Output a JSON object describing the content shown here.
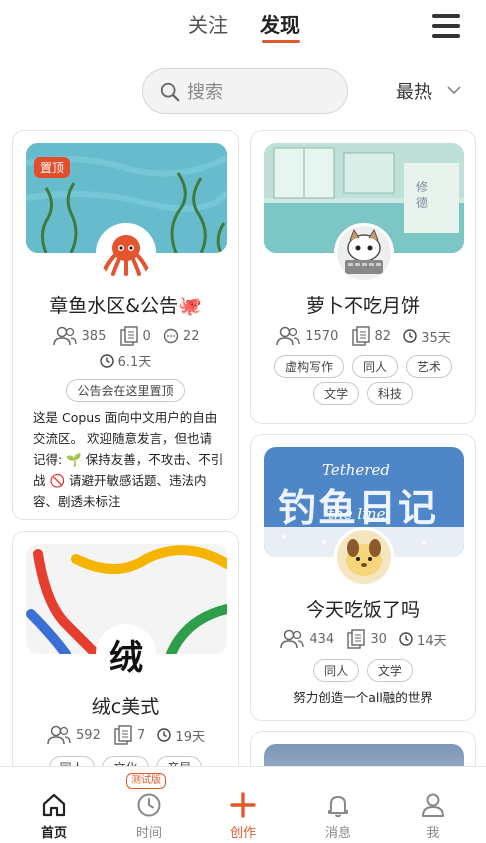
{
  "header": {
    "tabs": [
      {
        "label": "关注",
        "active": false
      },
      {
        "label": "发现",
        "active": true
      }
    ],
    "accent_color": "#e05a2b"
  },
  "search": {
    "placeholder": "搜索",
    "value": ""
  },
  "sort": {
    "label": "最热"
  },
  "cards": [
    {
      "title": "章鱼水区&公告🐙",
      "pinned_label": "置顶",
      "members": "385",
      "posts": "0",
      "comments": "22",
      "age": "6.1天",
      "tags": [
        "公告会在这里置顶"
      ],
      "description": "这是 Copus 面向中文用户的自由交流区。 欢迎随意发言，但也请记得: 🌱 保持友善，不攻击、不引战 🚫 请避开敏感话题、违法内容、剧透未标注"
    },
    {
      "title": "萝卜不吃月饼",
      "members": "1570",
      "posts": "82",
      "age": "35天",
      "tags": [
        "虚构写作",
        "同人",
        "艺术",
        "文学",
        "科技"
      ]
    },
    {
      "title": "今天吃饭了吗",
      "cover_text_1": "钓鱼日记",
      "cover_text_2": "Tethered",
      "cover_text_3": "the line",
      "members": "434",
      "posts": "30",
      "age": "14天",
      "tags": [
        "同人",
        "文学"
      ],
      "description": "努力创造一个all融的世界"
    },
    {
      "title": "绒c美式",
      "avatar_text": "绒",
      "members": "592",
      "posts": "7",
      "age": "19天",
      "tags": [
        "同人",
        "文化",
        "音异"
      ]
    }
  ],
  "bottom_nav": {
    "items": [
      {
        "label": "首页",
        "icon": "home-icon",
        "active": true
      },
      {
        "label": "时间",
        "icon": "clock-icon",
        "badge": "测试版"
      },
      {
        "label": "创作",
        "icon": "plus-icon"
      },
      {
        "label": "消息",
        "icon": "bell-icon"
      },
      {
        "label": "我",
        "icon": "user-icon"
      }
    ]
  }
}
